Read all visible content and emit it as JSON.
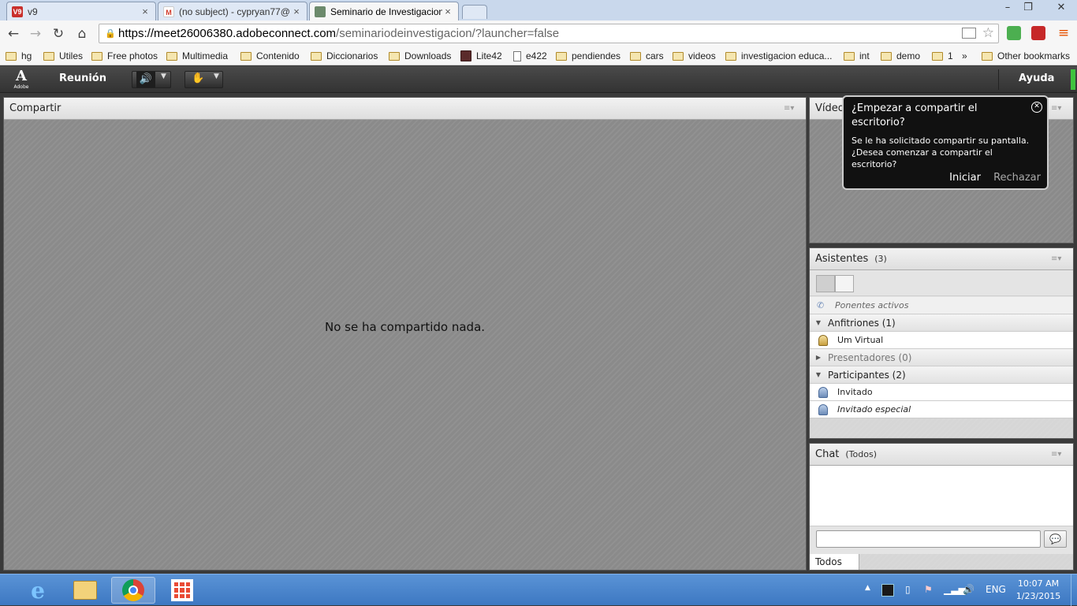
{
  "browser": {
    "tabs": [
      {
        "favicon": "V9",
        "title": "v9"
      },
      {
        "favicon": "M",
        "title": "(no subject) - cypryan77@"
      },
      {
        "favicon": "seminar-icon",
        "title": "Seminario de Investigacion"
      }
    ],
    "url_host": "https://meet26006380.adobeconnect.com",
    "url_path": "/seminariodeinvestigacion/?launcher=false",
    "bookmarks": [
      "hg",
      "Utiles",
      "Free photos",
      "Multimedia",
      "Contenido",
      "Diccionarios",
      "Downloads",
      "Lite42",
      "e422",
      "pendiendes",
      "cars",
      "videos",
      "investigacion educa...",
      "int",
      "demo",
      "1"
    ],
    "bookmarks_more": "»",
    "other_bookmarks": "Other bookmarks"
  },
  "connect": {
    "adobe_label": "Adobe",
    "menu_meeting": "Reunión",
    "menu_help": "Ayuda",
    "share_pod": {
      "title": "Compartir",
      "empty_message": "No se ha compartido nada."
    },
    "video_pod": {
      "title": "Vídeo"
    },
    "attendees_pod": {
      "title": "Asistentes",
      "count": "(3)",
      "active_speakers": "Ponentes activos",
      "groups": {
        "hosts": "Anfitriones (1)",
        "presenters": "Presentadores (0)",
        "participants": "Participantes (2)"
      },
      "host_users": [
        "Um Virtual"
      ],
      "participant_users": [
        "Invitado",
        "Invitado especial"
      ]
    },
    "chat_pod": {
      "title": "Chat",
      "scope": "(Todos)",
      "tab_all": "Todos"
    },
    "share_prompt": {
      "title": "¿Empezar a compartir el escritorio?",
      "body_line1": "Se le ha solicitado compartir su pantalla.",
      "body_line2": "¿Desea comenzar a compartir el escritorio?",
      "accept": "Iniciar",
      "decline": "Rechazar"
    }
  },
  "taskbar": {
    "language": "ENG",
    "time": "10:07 AM",
    "date": "1/23/2015"
  }
}
